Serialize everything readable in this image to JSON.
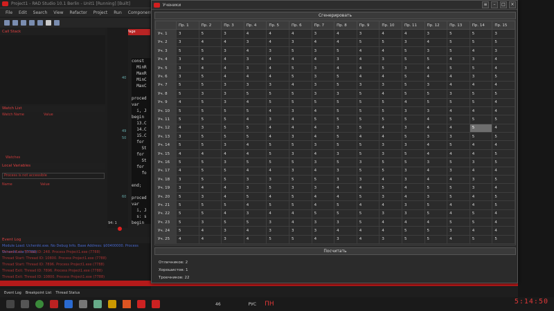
{
  "ide": {
    "title": "Project1 - RAD Studio 10.1 Berlin - Unit1 [Running] [Built]",
    "menu": [
      "File",
      "Edit",
      "Search",
      "View",
      "Refactor",
      "Project",
      "Run",
      "Component",
      "Tools"
    ],
    "call_stack": "Call Stack",
    "watch_list": "Watch List",
    "watch_cols": [
      "Watch Name",
      "Value"
    ],
    "watches_tab": "Watches",
    "local_vars": "Local Variables",
    "process_note": "Process is not accessible",
    "local_cols": [
      "Name",
      "Value"
    ],
    "welcome_tab": "Welcome Page",
    "code_lines": [
      "const",
      "  MinR",
      "  MaxR",
      "  MinC",
      "  MaxC",
      "",
      "proced",
      "var",
      "  i, J",
      "begin",
      "  13.C",
      "  14.C",
      "  15.C",
      "  for",
      "    St",
      "  for",
      "    St",
      "  for",
      "    fo",
      "",
      "end;",
      "",
      "proced",
      "var",
      "  i, J",
      "  s: s",
      "begin"
    ],
    "line_numbers": [
      "40",
      "49",
      "50",
      "60"
    ],
    "status_pos": "94: 1",
    "event_log": "Event Log",
    "event_lines": [
      "Module Load: Ucheniki.exe. No Debug Info. Base Address: $00400000. Process Ucheniki.exe (7788)",
      "Thread Exit: Thread ID: 248. Process Project1.exe (7788)",
      "Thread Start: Thread ID: 10800. Process Project1.exe (7788)",
      "Thread Start: Thread ID: 7896. Process Project1.exe (7788)",
      "Thread Exit: Thread ID: 7896. Process Project1.exe (7788)",
      "Thread Exit: Thread ID: 10800. Process Project1.exe (7788)",
      "Thread Start: Thread ID: 5860. Process Project1.exe (7788)"
    ],
    "bottom_tabs": [
      "Event Log",
      "Breakpoint List",
      "Thread Status"
    ]
  },
  "window": {
    "title": "Ученики",
    "generate_label": "Сгенерировать",
    "calc_label": "Посчитать",
    "columns": [
      "Пр. 1",
      "Пр. 2",
      "Пр. 3",
      "Пр. 4",
      "Пр. 5",
      "Пр. 6",
      "Пр. 7",
      "Пр. 8",
      "Пр. 9",
      "Пр. 10",
      "Пр. 11",
      "Пр. 12",
      "Пр. 13",
      "Пр. 14",
      "Пр. 15"
    ],
    "rows": [
      {
        "label": "Уч. 1",
        "v": [
          "3",
          "5",
          "3",
          "4",
          "4",
          "4",
          "3",
          "4",
          "3",
          "4",
          "4",
          "3",
          "5",
          "5",
          "3"
        ]
      },
      {
        "label": "Уч. 2",
        "v": [
          "3",
          "4",
          "4",
          "3",
          "4",
          "3",
          "4",
          "4",
          "5",
          "5",
          "3",
          "4",
          "5",
          "5",
          "5"
        ]
      },
      {
        "label": "Уч. 3",
        "v": [
          "5",
          "5",
          "3",
          "4",
          "3",
          "5",
          "3",
          "5",
          "4",
          "4",
          "5",
          "3",
          "5",
          "4",
          "3"
        ]
      },
      {
        "label": "Уч. 4",
        "v": [
          "3",
          "4",
          "4",
          "3",
          "4",
          "4",
          "4",
          "3",
          "4",
          "3",
          "5",
          "5",
          "4",
          "3",
          "4"
        ]
      },
      {
        "label": "Уч. 5",
        "v": [
          "3",
          "4",
          "4",
          "3",
          "4",
          "5",
          "3",
          "4",
          "4",
          "5",
          "3",
          "4",
          "5",
          "5",
          "4"
        ]
      },
      {
        "label": "Уч. 6",
        "v": [
          "3",
          "5",
          "4",
          "4",
          "4",
          "5",
          "3",
          "5",
          "4",
          "4",
          "5",
          "4",
          "4",
          "3",
          "5"
        ]
      },
      {
        "label": "Уч. 7",
        "v": [
          "5",
          "5",
          "3",
          "3",
          "3",
          "4",
          "3",
          "5",
          "3",
          "3",
          "5",
          "3",
          "4",
          "4",
          "4"
        ]
      },
      {
        "label": "Уч. 8",
        "v": [
          "5",
          "3",
          "3",
          "5",
          "5",
          "5",
          "3",
          "3",
          "5",
          "4",
          "5",
          "5",
          "3",
          "5",
          "5"
        ]
      },
      {
        "label": "Уч. 9",
        "v": [
          "4",
          "5",
          "3",
          "4",
          "5",
          "5",
          "5",
          "5",
          "5",
          "5",
          "4",
          "5",
          "5",
          "5",
          "4"
        ]
      },
      {
        "label": "Уч. 10",
        "v": [
          "5",
          "5",
          "5",
          "5",
          "4",
          "3",
          "4",
          "5",
          "5",
          "5",
          "3",
          "3",
          "4",
          "4",
          "4"
        ]
      },
      {
        "label": "Уч. 11",
        "v": [
          "5",
          "5",
          "5",
          "4",
          "3",
          "4",
          "5",
          "5",
          "5",
          "5",
          "5",
          "4",
          "5",
          "5",
          "5"
        ]
      },
      {
        "label": "Уч. 12",
        "v": [
          "4",
          "3",
          "5",
          "5",
          "4",
          "4",
          "4",
          "3",
          "5",
          "4",
          "3",
          "4",
          "4",
          "5",
          "4"
        ]
      },
      {
        "label": "Уч. 13",
        "v": [
          "3",
          "5",
          "5",
          "5",
          "4",
          "3",
          "4",
          "5",
          "4",
          "4",
          "5",
          "3",
          "3",
          "5",
          "5"
        ]
      },
      {
        "label": "Уч. 14",
        "v": [
          "5",
          "5",
          "3",
          "4",
          "5",
          "5",
          "3",
          "5",
          "5",
          "3",
          "3",
          "4",
          "5",
          "4",
          "4"
        ]
      },
      {
        "label": "Уч. 15",
        "v": [
          "4",
          "4",
          "4",
          "4",
          "5",
          "3",
          "4",
          "3",
          "5",
          "3",
          "5",
          "4",
          "4",
          "4",
          "5"
        ]
      },
      {
        "label": "Уч. 16",
        "v": [
          "5",
          "5",
          "3",
          "5",
          "5",
          "5",
          "3",
          "5",
          "3",
          "5",
          "5",
          "3",
          "5",
          "3",
          "5"
        ]
      },
      {
        "label": "Уч. 17",
        "v": [
          "4",
          "5",
          "5",
          "4",
          "4",
          "3",
          "4",
          "3",
          "5",
          "5",
          "3",
          "4",
          "3",
          "4",
          "4"
        ]
      },
      {
        "label": "Уч. 18",
        "v": [
          "3",
          "5",
          "5",
          "3",
          "3",
          "5",
          "5",
          "3",
          "3",
          "4",
          "3",
          "4",
          "4",
          "3",
          "5"
        ]
      },
      {
        "label": "Уч. 19",
        "v": [
          "3",
          "4",
          "4",
          "3",
          "5",
          "3",
          "3",
          "4",
          "4",
          "5",
          "4",
          "5",
          "5",
          "3",
          "4"
        ]
      },
      {
        "label": "Уч. 20",
        "v": [
          "5",
          "3",
          "4",
          "5",
          "4",
          "5",
          "4",
          "4",
          "5",
          "3",
          "4",
          "3",
          "5",
          "4",
          "5"
        ]
      },
      {
        "label": "Уч. 21",
        "v": [
          "5",
          "5",
          "5",
          "4",
          "5",
          "5",
          "4",
          "5",
          "4",
          "4",
          "3",
          "5",
          "4",
          "4",
          "5"
        ]
      },
      {
        "label": "Уч. 22",
        "v": [
          "5",
          "5",
          "4",
          "3",
          "4",
          "4",
          "5",
          "5",
          "5",
          "3",
          "3",
          "5",
          "4",
          "5",
          "4"
        ]
      },
      {
        "label": "Уч. 23",
        "v": [
          "5",
          "3",
          "5",
          "5",
          "3",
          "4",
          "3",
          "3",
          "5",
          "4",
          "4",
          "4",
          "5",
          "5",
          "4"
        ]
      },
      {
        "label": "Уч. 24",
        "v": [
          "5",
          "4",
          "3",
          "4",
          "3",
          "3",
          "3",
          "4",
          "4",
          "4",
          "5",
          "5",
          "3",
          "4",
          "4"
        ]
      },
      {
        "label": "Уч. 25",
        "v": [
          "4",
          "4",
          "3",
          "4",
          "5",
          "5",
          "4",
          "3",
          "4",
          "3",
          "5",
          "5",
          "4",
          "5",
          "5"
        ]
      }
    ],
    "selected": {
      "row": 11,
      "col": 13
    },
    "stats": {
      "excellent": "Отличников:  2",
      "good": "Хорошистов:  1",
      "satisfactory": "Троечников:  22"
    }
  },
  "taskbar": {
    "clock": "5:14:50",
    "tray_num": "46",
    "lang": "РУС",
    "day": "ПН"
  }
}
